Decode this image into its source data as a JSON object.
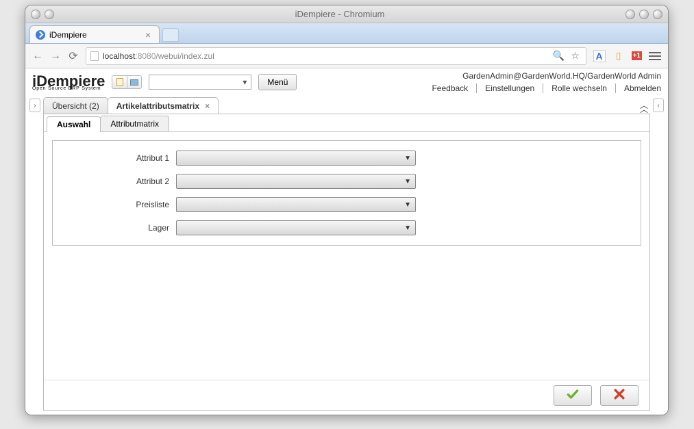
{
  "os": {
    "title": "iDempiere - Chromium"
  },
  "browser": {
    "tab_title": "iDempiere",
    "url_host": "localhost",
    "url_port": ":8080",
    "url_path": "/webui/index.zul"
  },
  "app_header": {
    "brand": "iDempiere",
    "brand_sub": "Open Source ERP System",
    "menu_button": "Menü",
    "user_line": "GardenAdmin@GardenWorld.HQ/GardenWorld Admin",
    "links": {
      "feedback": "Feedback",
      "settings": "Einstellungen",
      "switch_role": "Rolle wechseln",
      "logout": "Abmelden"
    }
  },
  "top_tabs": {
    "overview": "Übersicht (2)",
    "matrix": "Artikelattributsmatrix"
  },
  "sub_tabs": {
    "selection": "Auswahl",
    "matrix": "Attributmatrix"
  },
  "form": {
    "attr1": {
      "label": "Attribut 1",
      "value": ""
    },
    "attr2": {
      "label": "Attribut 2",
      "value": ""
    },
    "pricelist": {
      "label": "Preisliste",
      "value": ""
    },
    "warehouse": {
      "label": "Lager",
      "value": ""
    }
  }
}
